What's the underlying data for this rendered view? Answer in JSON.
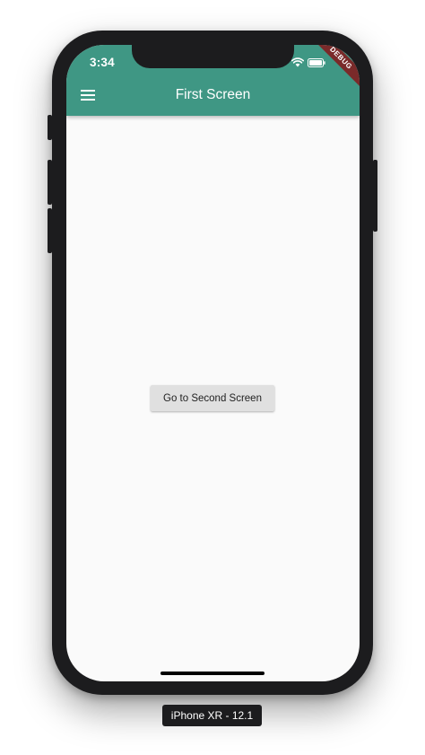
{
  "status_bar": {
    "time": "3:34",
    "icons": [
      "signal-dots-icon",
      "wifi-icon",
      "battery-icon"
    ]
  },
  "debug_banner": {
    "label": "DEBUG",
    "color": "#7a2a2a"
  },
  "app_bar": {
    "title": "First Screen",
    "menu_icon": "hamburger-menu-icon",
    "color": "#3f9784"
  },
  "main": {
    "button_label": "Go to Second Screen"
  },
  "simulator": {
    "device_label": "iPhone XR - 12.1"
  }
}
